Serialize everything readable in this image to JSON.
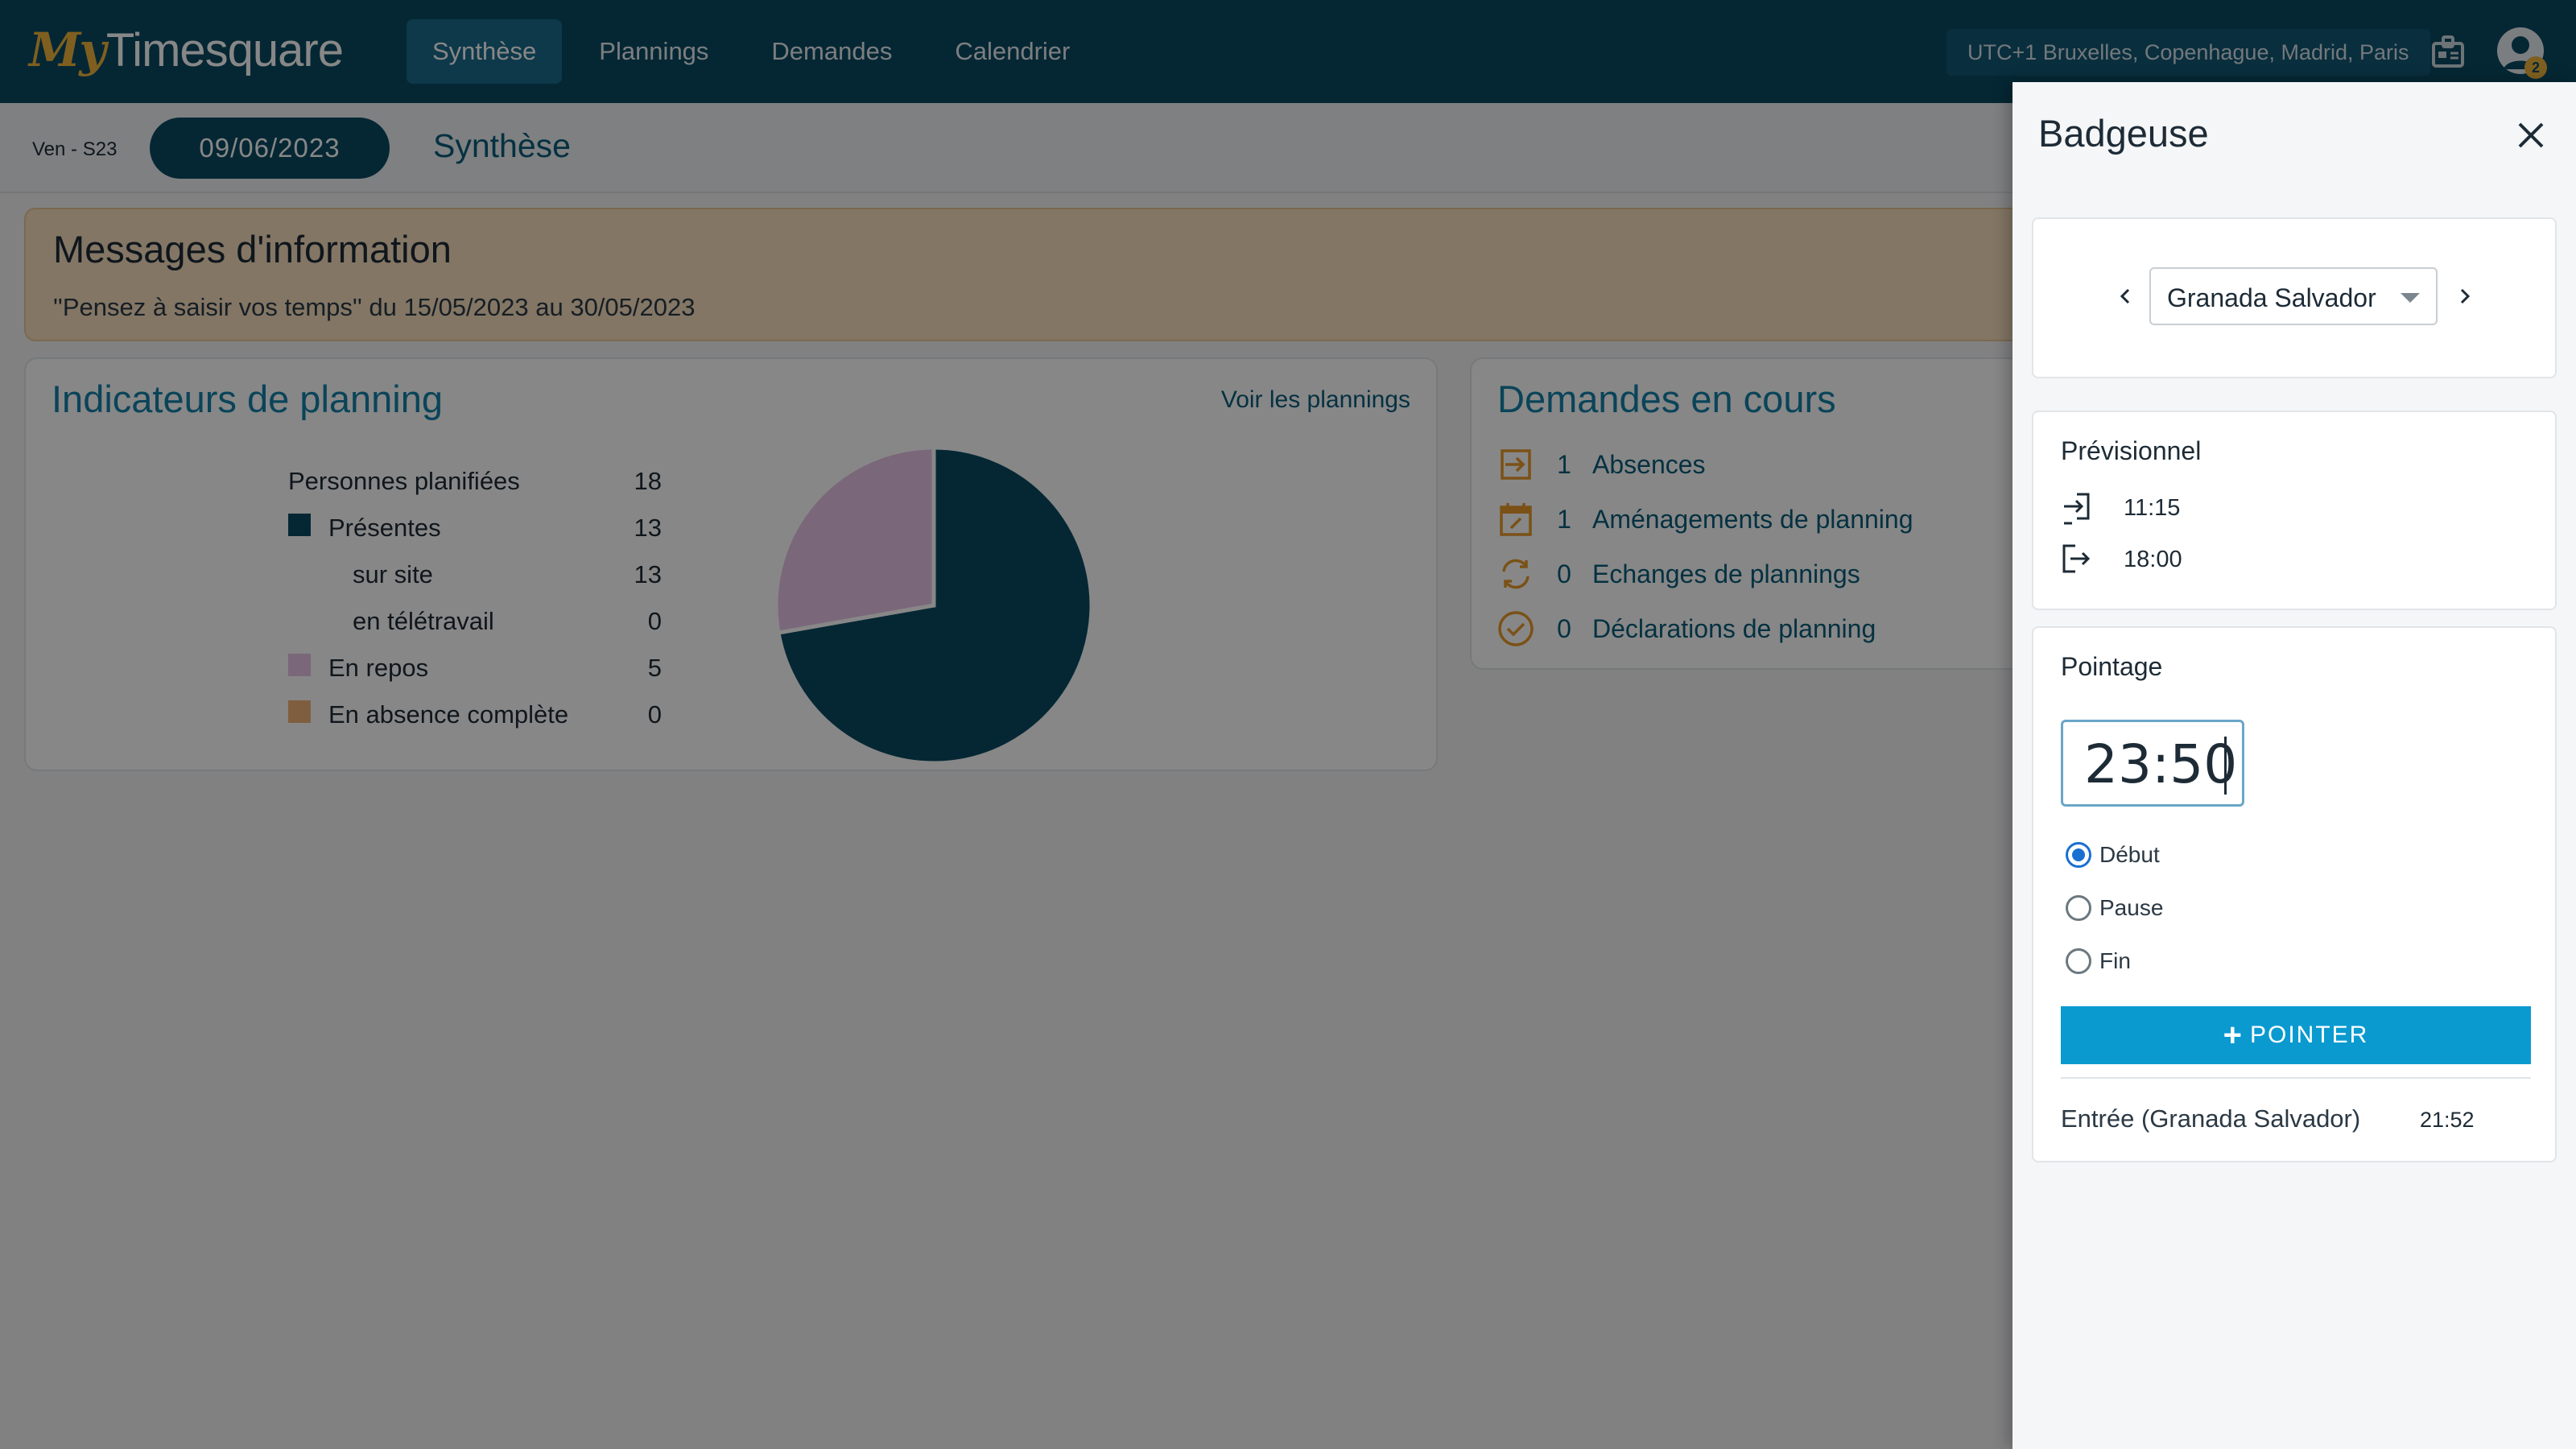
{
  "app": {
    "logo_my": "My",
    "logo_name": "Timesquare",
    "nav": [
      "Synthèse",
      "Plannings",
      "Demandes",
      "Calendrier"
    ],
    "active_nav": "Synthèse",
    "timezone": "UTC+1 Bruxelles, Copenhague, Madrid, Paris",
    "avatar_badge": "2"
  },
  "subbar": {
    "weekday": "Ven - S23",
    "date": "09/06/2023",
    "page_title": "Synthèse"
  },
  "messages": {
    "title": "Messages d'information",
    "text": "''Pensez à saisir vos temps'' du 15/05/2023 au 30/05/2023"
  },
  "indicators": {
    "title": "Indicateurs de planning",
    "link": "Voir les plannings",
    "rows": [
      {
        "label": "Personnes planifiées",
        "value": "18"
      },
      {
        "label": "Présentes",
        "value": "13",
        "color": "#0a4a63"
      },
      {
        "label": "sur site",
        "value": "13"
      },
      {
        "label": "en télétravail",
        "value": "0"
      },
      {
        "label": "En repos",
        "value": "5",
        "color": "#e6c4e6"
      },
      {
        "label": "En absence complète",
        "value": "0",
        "color": "#f0b27a"
      }
    ]
  },
  "chart_data": {
    "type": "pie",
    "categories": [
      "Présentes",
      "En repos",
      "En absence complète"
    ],
    "values": [
      13,
      5,
      0
    ],
    "colors": [
      "#0a4a63",
      "#e6c4e6",
      "#f0b27a"
    ]
  },
  "demandes": {
    "title": "Demandes en cours",
    "items": [
      {
        "count": "1",
        "label": "Absences",
        "icon": "arrow-in-icon"
      },
      {
        "count": "1",
        "label": "Aménagements de planning",
        "icon": "calendar-edit-icon"
      },
      {
        "count": "0",
        "label": "Echanges de plannings",
        "icon": "swap-icon"
      },
      {
        "count": "0",
        "label": "Déclarations de planning",
        "icon": "check-circle-icon"
      }
    ]
  },
  "panel": {
    "title": "Badgeuse",
    "person": "Granada Salvador",
    "previsionnel": {
      "title": "Prévisionnel",
      "start": "11:15",
      "end": "18:00"
    },
    "pointage": {
      "title": "Pointage",
      "time": "23:50",
      "options": [
        "Début",
        "Pause",
        "Fin"
      ],
      "selected": "Début",
      "button": "POINTER",
      "entry_label": "Entrée (Granada Salvador)",
      "entry_time": "21:52"
    }
  }
}
